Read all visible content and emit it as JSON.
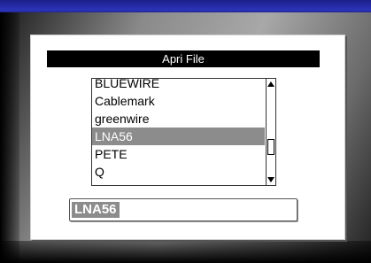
{
  "dialog": {
    "title": "Apri File"
  },
  "file_list": {
    "items": [
      {
        "label": "BLUEWIRE",
        "selected": false
      },
      {
        "label": "Cablemark",
        "selected": false
      },
      {
        "label": "greenwire",
        "selected": false
      },
      {
        "label": "LNA56",
        "selected": true
      },
      {
        "label": "PETE",
        "selected": false
      },
      {
        "label": "Q",
        "selected": false
      }
    ]
  },
  "filename_input": {
    "value": "LNA56"
  },
  "colors": {
    "title_bar": "#000000",
    "selection": "#8c8c8c",
    "bezel_blue": "#2b33b8"
  }
}
